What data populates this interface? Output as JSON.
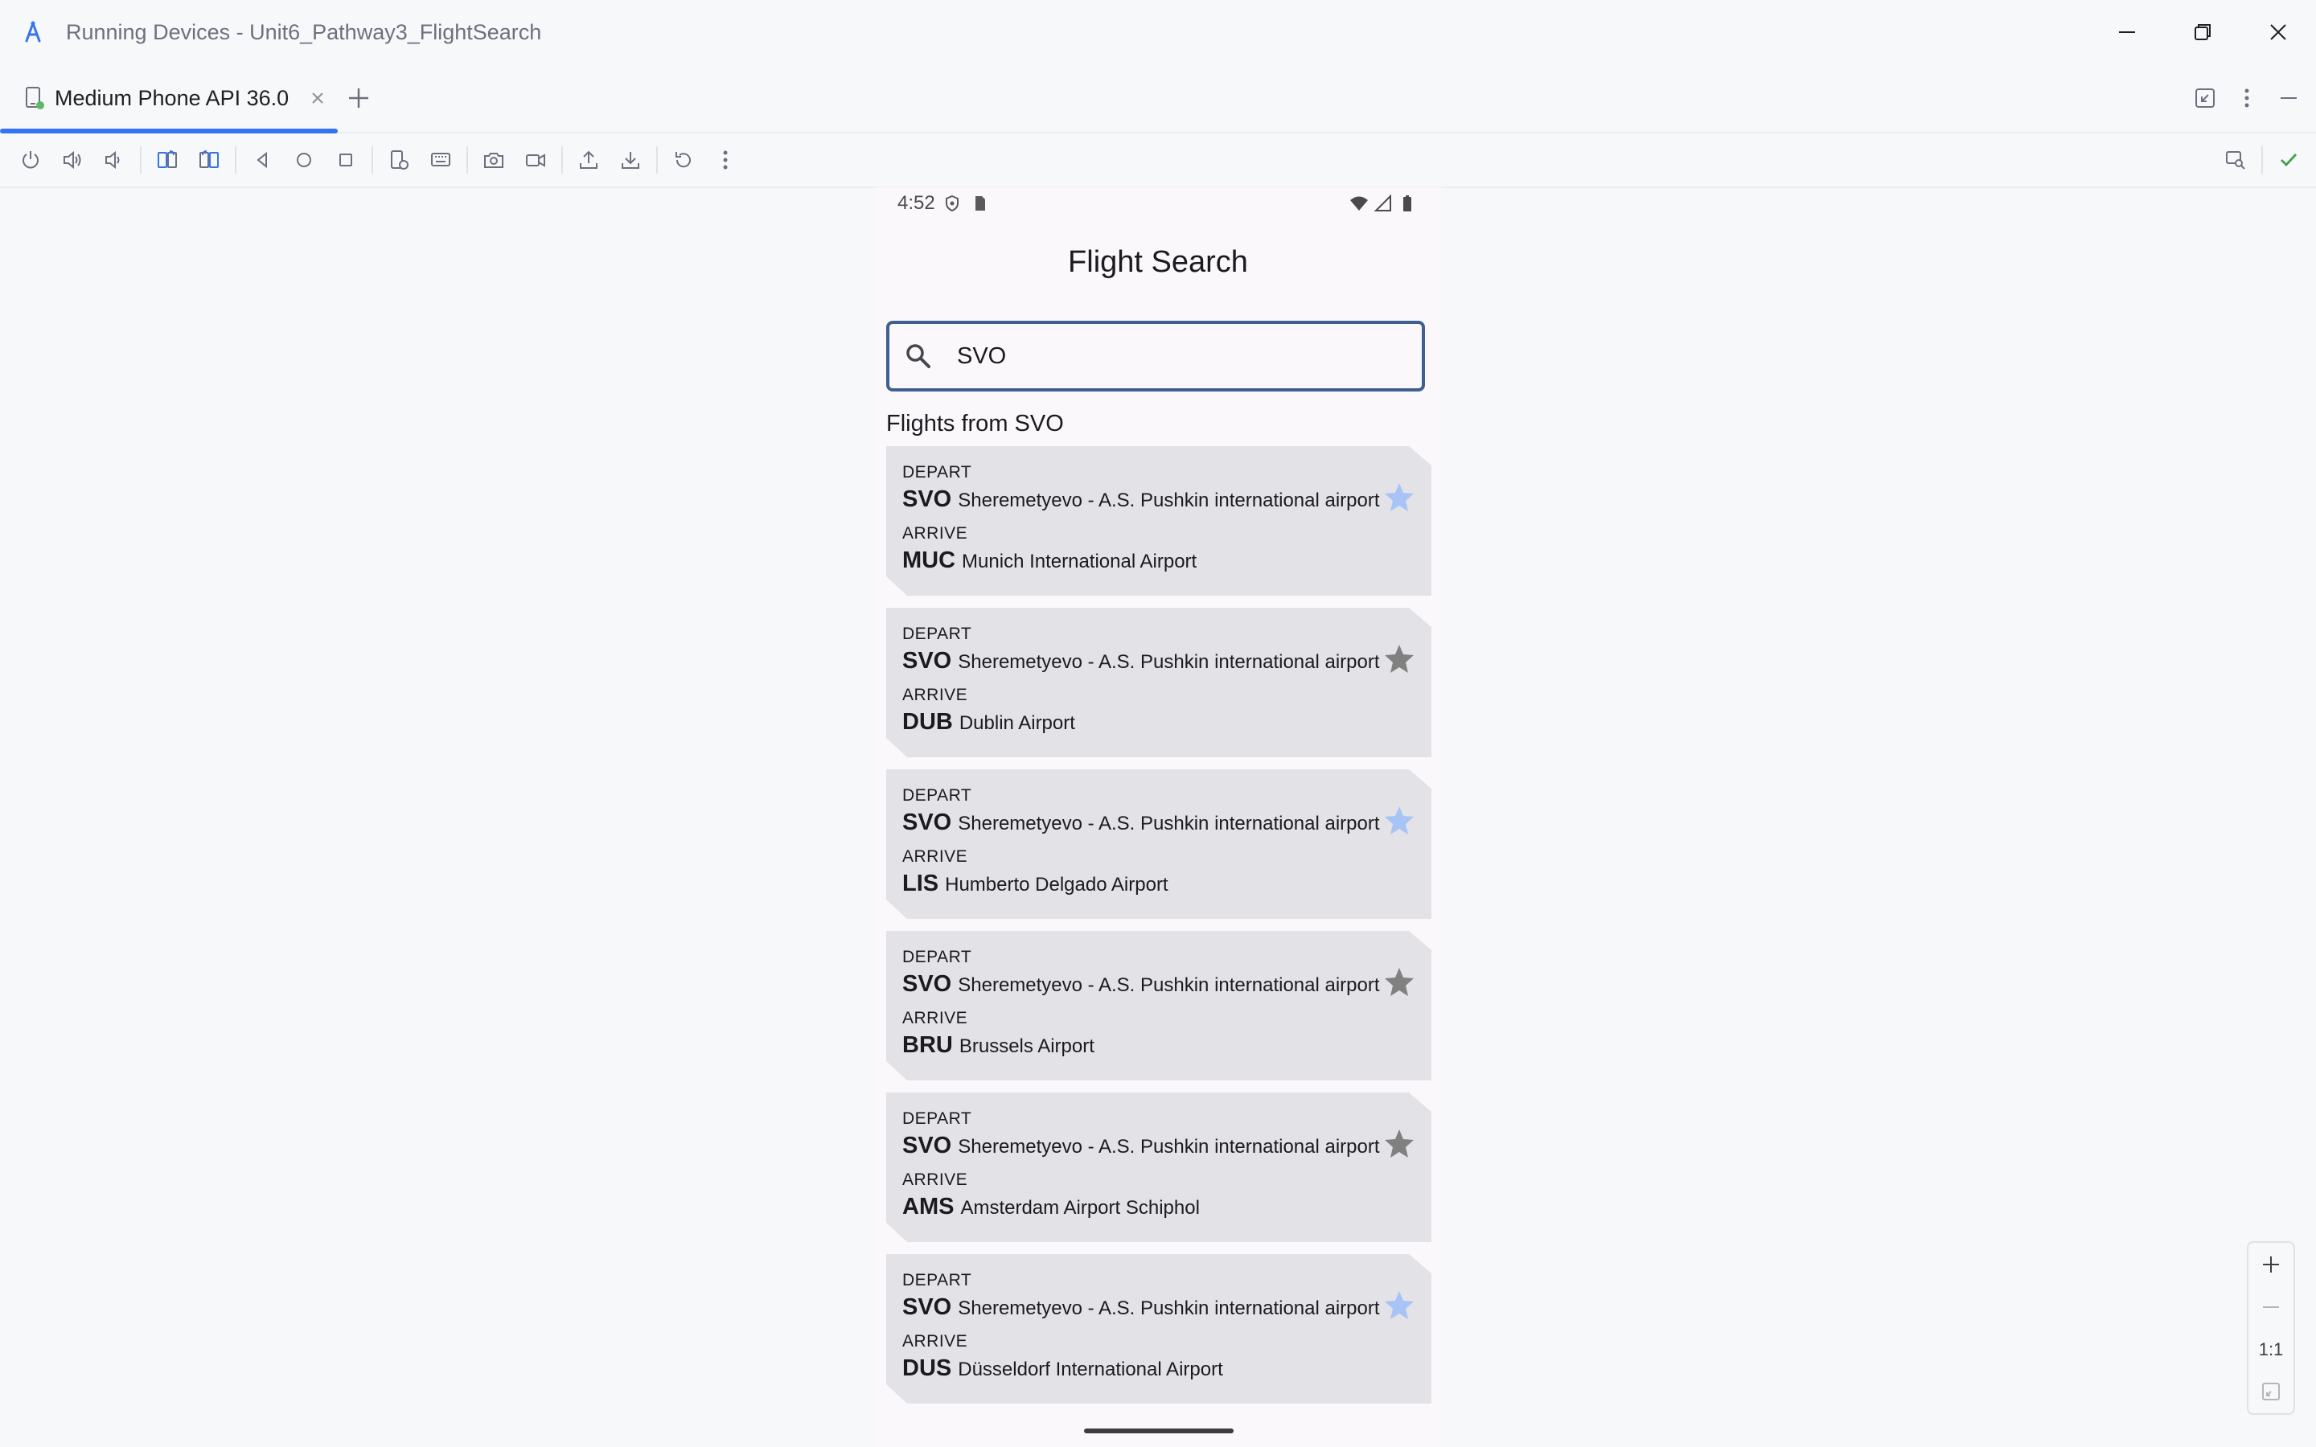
{
  "window": {
    "title": "Running Devices - Unit6_Pathway3_FlightSearch"
  },
  "tabs": [
    {
      "label": "Medium Phone API 36.0",
      "active": true
    }
  ],
  "device": {
    "status_bar": {
      "time": "4:52"
    },
    "app_title": "Flight Search",
    "search": {
      "value": "SVO",
      "placeholder": ""
    },
    "section_title": "Flights from SVO",
    "labels": {
      "depart": "DEPART",
      "arrive": "ARRIVE"
    },
    "flights": [
      {
        "depart_code": "SVO",
        "depart_name": "Sheremetyevo - A.S. Pushkin international airport",
        "arrive_code": "MUC",
        "arrive_name": "Munich International Airport",
        "favorite": true
      },
      {
        "depart_code": "SVO",
        "depart_name": "Sheremetyevo - A.S. Pushkin international airport",
        "arrive_code": "DUB",
        "arrive_name": "Dublin Airport",
        "favorite": false
      },
      {
        "depart_code": "SVO",
        "depart_name": "Sheremetyevo - A.S. Pushkin international airport",
        "arrive_code": "LIS",
        "arrive_name": "Humberto Delgado Airport",
        "favorite": true
      },
      {
        "depart_code": "SVO",
        "depart_name": "Sheremetyevo - A.S. Pushkin international airport",
        "arrive_code": "BRU",
        "arrive_name": "Brussels Airport",
        "favorite": false
      },
      {
        "depart_code": "SVO",
        "depart_name": "Sheremetyevo - A.S. Pushkin international airport",
        "arrive_code": "AMS",
        "arrive_name": "Amsterdam Airport Schiphol",
        "favorite": false
      },
      {
        "depart_code": "SVO",
        "depart_name": "Sheremetyevo - A.S. Pushkin international airport",
        "arrive_code": "DUS",
        "arrive_name": "Düsseldorf International Airport",
        "favorite": true
      }
    ]
  },
  "zoom_panel": {
    "reset_label": "1:1"
  },
  "colors": {
    "accent": "#3574f0",
    "search_border": "#3e5f90",
    "card_bg": "#e2e2e7",
    "star_favorite": "#a8c3f5",
    "star_default": "#808080",
    "check_green": "#45a046"
  },
  "icons": {
    "window": [
      "app-logo-icon",
      "minimize-icon",
      "restore-icon",
      "close-icon"
    ],
    "toolbar": [
      "power-icon",
      "volume-up-icon",
      "volume-down-icon",
      "rotate-left-icon",
      "rotate-right-icon",
      "back-icon",
      "home-icon",
      "overview-icon",
      "device-state-icon",
      "keyboard-icon",
      "screenshot-icon",
      "screen-record-icon",
      "push-icon",
      "pull-icon",
      "reset-icon",
      "more-icon",
      "ui-inspect-icon",
      "check-icon"
    ]
  }
}
